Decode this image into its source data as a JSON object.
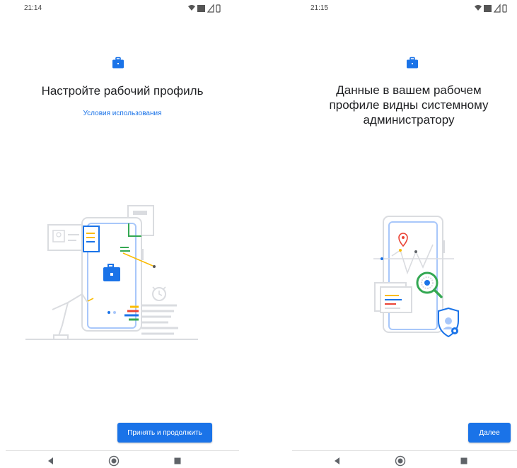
{
  "colors": {
    "accent": "#1a73e8",
    "text": "#202124",
    "illustration_line": "#dadce0",
    "green": "#34a853",
    "yellow": "#fbbc04",
    "red": "#ea4335"
  },
  "screens": [
    {
      "status": {
        "time": "21:14",
        "icons": [
          "wifi-icon",
          "lte-icon",
          "signal-icon",
          "battery-icon"
        ]
      },
      "icon": "briefcase-icon",
      "title": "Настройте рабочий профиль",
      "link": "Условия использования",
      "illustration": "work-profile-setup-illustration",
      "button": "Принять и продолжить",
      "nav": [
        "back-icon",
        "home-icon",
        "recents-icon"
      ]
    },
    {
      "status": {
        "time": "21:15",
        "icons": [
          "wifi-icon",
          "lte-icon",
          "signal-icon",
          "battery-icon"
        ]
      },
      "icon": "briefcase-icon",
      "title_lines": [
        "Данные в вашем рабочем",
        "профиле видны системному",
        "администратору"
      ],
      "illustration": "admin-visibility-illustration",
      "button": "Далее",
      "nav": [
        "back-icon",
        "home-icon",
        "recents-icon"
      ]
    }
  ]
}
